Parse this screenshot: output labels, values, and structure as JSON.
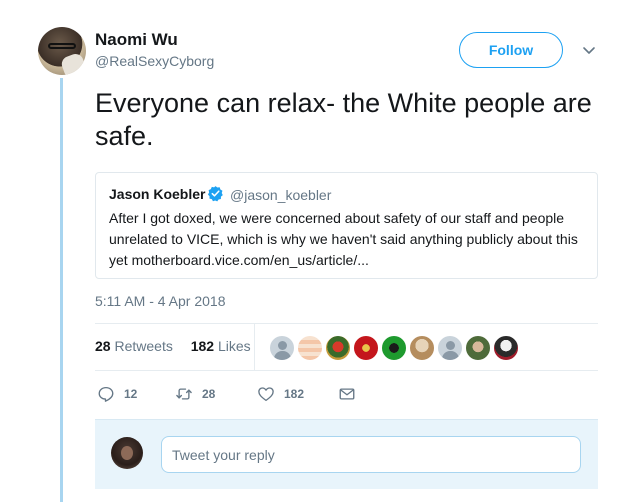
{
  "tweet": {
    "author_name": "Naomi Wu",
    "author_handle": "@RealSexyCyborg",
    "follow_label": "Follow",
    "text": "Everyone can relax- the White people are safe.",
    "timestamp": "5:11 AM - 4 Apr 2018"
  },
  "quote": {
    "author_name": "Jason Koebler",
    "author_handle": "@jason_koebler",
    "verified_icon": "verified-badge-icon",
    "text": "After I got doxed, we were concerned about safety of our staff and people unrelated to VICE, which is why we haven't said anything publicly about this yet motherboard.vice.com/en_us/article/..."
  },
  "stats": {
    "retweets_count": "28",
    "retweets_label": "Retweets",
    "likes_count": "182",
    "likes_label": "Likes"
  },
  "actions": {
    "reply_count": "12",
    "retweet_count": "28",
    "like_count": "182"
  },
  "reply": {
    "placeholder": "Tweet your reply"
  },
  "colors": {
    "accent": "#1da1f2",
    "verified": "#1da1f2",
    "muted": "#657786",
    "thread_line": "#a8d5f0",
    "reply_bg": "#e8f4fb"
  }
}
